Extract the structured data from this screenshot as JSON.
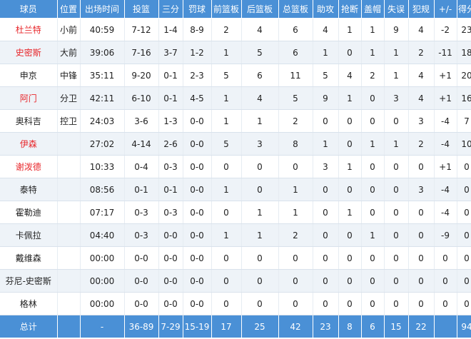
{
  "headers": [
    "球员",
    "位置",
    "出场时间",
    "投篮",
    "三分",
    "罚球",
    "前篮板",
    "后篮板",
    "总篮板",
    "助攻",
    "抢断",
    "盖帽",
    "失误",
    "犯规",
    "+/-",
    "得分"
  ],
  "players": [
    {
      "name": "杜兰特",
      "pos": "小前",
      "min": "40:59",
      "fg": "7-12",
      "tp": "1-4",
      "ft": "8-9",
      "oreb": "2",
      "dreb": "4",
      "reb": "6",
      "ast": "4",
      "stl": "1",
      "blk": "1",
      "tov": "9",
      "pf": "4",
      "pm": "-2",
      "pts": "23",
      "red": true
    },
    {
      "name": "史密斯",
      "pos": "大前",
      "min": "39:06",
      "fg": "7-16",
      "tp": "3-7",
      "ft": "1-2",
      "oreb": "1",
      "dreb": "5",
      "reb": "6",
      "ast": "1",
      "stl": "0",
      "blk": "1",
      "tov": "1",
      "pf": "2",
      "pm": "-11",
      "pts": "18",
      "red": true
    },
    {
      "name": "申京",
      "pos": "中锋",
      "min": "35:11",
      "fg": "9-20",
      "tp": "0-1",
      "ft": "2-3",
      "oreb": "5",
      "dreb": "6",
      "reb": "11",
      "ast": "5",
      "stl": "4",
      "blk": "2",
      "tov": "1",
      "pf": "4",
      "pm": "+1",
      "pts": "20",
      "red": false
    },
    {
      "name": "阿门",
      "pos": "分卫",
      "min": "42:11",
      "fg": "6-10",
      "tp": "0-1",
      "ft": "4-5",
      "oreb": "1",
      "dreb": "4",
      "reb": "5",
      "ast": "9",
      "stl": "1",
      "blk": "0",
      "tov": "3",
      "pf": "4",
      "pm": "+1",
      "pts": "16",
      "red": true
    },
    {
      "name": "奥科吉",
      "pos": "控卫",
      "min": "24:03",
      "fg": "3-6",
      "tp": "1-3",
      "ft": "0-0",
      "oreb": "1",
      "dreb": "1",
      "reb": "2",
      "ast": "0",
      "stl": "0",
      "blk": "0",
      "tov": "0",
      "pf": "3",
      "pm": "-4",
      "pts": "7",
      "red": false
    },
    {
      "name": "伊森",
      "pos": "",
      "min": "27:02",
      "fg": "4-14",
      "tp": "2-6",
      "ft": "0-0",
      "oreb": "5",
      "dreb": "3",
      "reb": "8",
      "ast": "1",
      "stl": "0",
      "blk": "1",
      "tov": "1",
      "pf": "2",
      "pm": "-4",
      "pts": "10",
      "red": true
    },
    {
      "name": "谢泼德",
      "pos": "",
      "min": "10:33",
      "fg": "0-4",
      "tp": "0-3",
      "ft": "0-0",
      "oreb": "0",
      "dreb": "0",
      "reb": "0",
      "ast": "3",
      "stl": "1",
      "blk": "0",
      "tov": "0",
      "pf": "0",
      "pm": "+1",
      "pts": "0",
      "red": true
    },
    {
      "name": "泰特",
      "pos": "",
      "min": "08:56",
      "fg": "0-1",
      "tp": "0-1",
      "ft": "0-0",
      "oreb": "1",
      "dreb": "0",
      "reb": "1",
      "ast": "0",
      "stl": "0",
      "blk": "0",
      "tov": "0",
      "pf": "3",
      "pm": "-4",
      "pts": "0",
      "red": false
    },
    {
      "name": "霍勒迪",
      "pos": "",
      "min": "07:17",
      "fg": "0-3",
      "tp": "0-3",
      "ft": "0-0",
      "oreb": "0",
      "dreb": "1",
      "reb": "1",
      "ast": "0",
      "stl": "1",
      "blk": "0",
      "tov": "0",
      "pf": "0",
      "pm": "-4",
      "pts": "0",
      "red": false
    },
    {
      "name": "卡佩拉",
      "pos": "",
      "min": "04:40",
      "fg": "0-3",
      "tp": "0-0",
      "ft": "0-0",
      "oreb": "1",
      "dreb": "1",
      "reb": "2",
      "ast": "0",
      "stl": "0",
      "blk": "1",
      "tov": "0",
      "pf": "0",
      "pm": "-9",
      "pts": "0",
      "red": false
    },
    {
      "name": "戴维森",
      "pos": "",
      "min": "00:00",
      "fg": "0-0",
      "tp": "0-0",
      "ft": "0-0",
      "oreb": "0",
      "dreb": "0",
      "reb": "0",
      "ast": "0",
      "stl": "0",
      "blk": "0",
      "tov": "0",
      "pf": "0",
      "pm": "0",
      "pts": "0",
      "red": false
    },
    {
      "name": "芬尼-史密斯",
      "pos": "",
      "min": "00:00",
      "fg": "0-0",
      "tp": "0-0",
      "ft": "0-0",
      "oreb": "0",
      "dreb": "0",
      "reb": "0",
      "ast": "0",
      "stl": "0",
      "blk": "0",
      "tov": "0",
      "pf": "0",
      "pm": "0",
      "pts": "0",
      "red": false
    },
    {
      "name": "格林",
      "pos": "",
      "min": "00:00",
      "fg": "0-0",
      "tp": "0-0",
      "ft": "0-0",
      "oreb": "0",
      "dreb": "0",
      "reb": "0",
      "ast": "0",
      "stl": "0",
      "blk": "0",
      "tov": "0",
      "pf": "0",
      "pm": "0",
      "pts": "0",
      "red": false
    }
  ],
  "totals": {
    "name": "总计",
    "pos": "",
    "min": "-",
    "fg": "36-89",
    "tp": "7-29",
    "ft": "15-19",
    "oreb": "17",
    "dreb": "25",
    "reb": "42",
    "ast": "23",
    "stl": "8",
    "blk": "6",
    "tov": "15",
    "pf": "22",
    "pm": "",
    "pts": "94"
  },
  "colors": {
    "header_bg": "#4a90d6",
    "highlight_name": "#e8262a",
    "stripe": "#eef3f8"
  }
}
